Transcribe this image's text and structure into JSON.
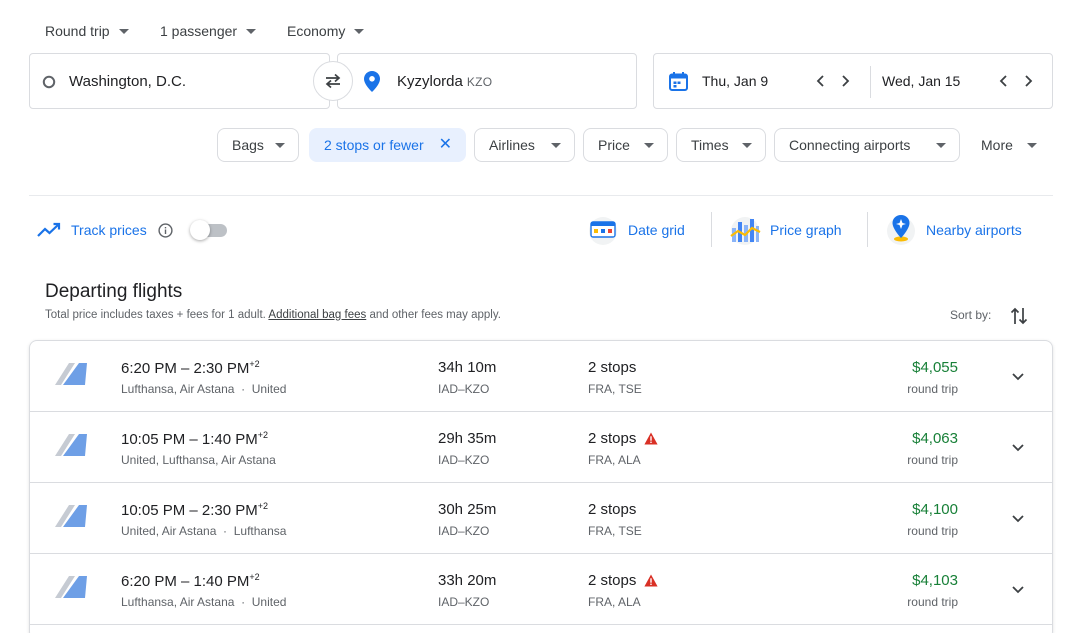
{
  "top": {
    "trip_type": "Round trip",
    "passengers": "1 passenger",
    "cabin": "Economy"
  },
  "search": {
    "origin": "Washington, D.C.",
    "destination": "Kyzylorda",
    "destination_code": "KZO",
    "depart_date": "Thu, Jan 9",
    "return_date": "Wed, Jan 15"
  },
  "filters": {
    "bags": "Bags",
    "stops": "2 stops or fewer",
    "airlines": "Airlines",
    "price": "Price",
    "times": "Times",
    "connecting": "Connecting airports",
    "more": "More"
  },
  "tools": {
    "track_prices": "Track prices",
    "date_grid": "Date grid",
    "price_graph": "Price graph",
    "nearby_airports": "Nearby airports"
  },
  "results": {
    "heading": "Departing flights",
    "note_prefix": "Total price includes taxes + fees for 1 adult.",
    "note_link": "Additional bag fees",
    "note_suffix": "and other fees may apply.",
    "sort_label": "Sort by:"
  },
  "flights": [
    {
      "times": "6:20 PM – 2:30 PM",
      "day_offset": "+2",
      "carriers": "Lufthansa, Air Astana",
      "operated": "United",
      "duration": "34h 10m",
      "route": "IAD–KZO",
      "stops": "2 stops",
      "stop_cities": "FRA, TSE",
      "price": "$4,055",
      "price_type": "round trip",
      "warning": false
    },
    {
      "times": "10:05 PM – 1:40 PM",
      "day_offset": "+2",
      "carriers": "United, Lufthansa, Air Astana",
      "operated": "",
      "duration": "29h 35m",
      "route": "IAD–KZO",
      "stops": "2 stops",
      "stop_cities": "FRA, ALA",
      "price": "$4,063",
      "price_type": "round trip",
      "warning": true
    },
    {
      "times": "10:05 PM – 2:30 PM",
      "day_offset": "+2",
      "carriers": "United, Air Astana",
      "operated": "Lufthansa",
      "duration": "30h 25m",
      "route": "IAD–KZO",
      "stops": "2 stops",
      "stop_cities": "FRA, TSE",
      "price": "$4,100",
      "price_type": "round trip",
      "warning": false
    },
    {
      "times": "6:20 PM – 1:40 PM",
      "day_offset": "+2",
      "carriers": "Lufthansa, Air Astana",
      "operated": "United",
      "duration": "33h 20m",
      "route": "IAD–KZO",
      "stops": "2 stops",
      "stop_cities": "FRA, ALA",
      "price": "$4,103",
      "price_type": "round trip",
      "warning": true
    }
  ],
  "colors": {
    "accent": "#1a73e8",
    "price": "#188038",
    "warning": "#d93025"
  }
}
